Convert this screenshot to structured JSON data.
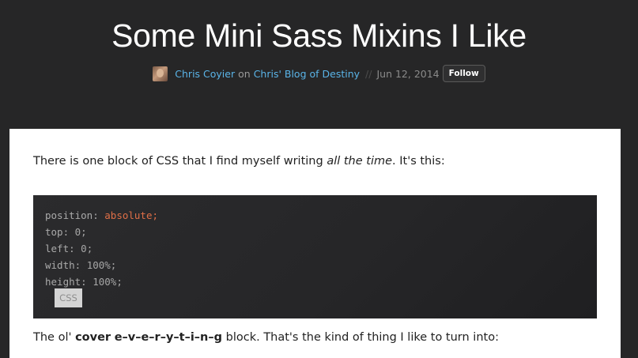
{
  "header": {
    "title": "Some Mini Sass Mixins I Like",
    "author": "Chris Coyier",
    "on_text": "on",
    "blog": "Chris' Blog of Destiny",
    "separator": "//",
    "date": "Jun 12, 2014",
    "follow_label": "Follow"
  },
  "article": {
    "para1": {
      "before": "There is one block of CSS that I find myself writing ",
      "emphasis": "all the time",
      "after": ". It's this:"
    },
    "code": {
      "lines": [
        {
          "prop": "position:",
          "value": "absolute;",
          "highlight": true
        },
        {
          "prop": "top:",
          "value": "0;",
          "highlight": false
        },
        {
          "prop": "left:",
          "value": "0;",
          "highlight": false
        },
        {
          "prop": "width:",
          "value": "100%;",
          "highlight": false
        },
        {
          "prop": "height:",
          "value": "100%;",
          "highlight": false
        }
      ],
      "language_label": "CSS"
    },
    "para2": {
      "before": "The ol' ",
      "bold1": "cover",
      "bold2": "e–v–e–r–y–t–i–n–g",
      "after": " block. That's the kind of thing I like to turn into:"
    }
  },
  "colors": {
    "background": "#262627",
    "link": "#5ab4e8",
    "code_keyword": "#e06f47",
    "code_background": "#262628"
  }
}
